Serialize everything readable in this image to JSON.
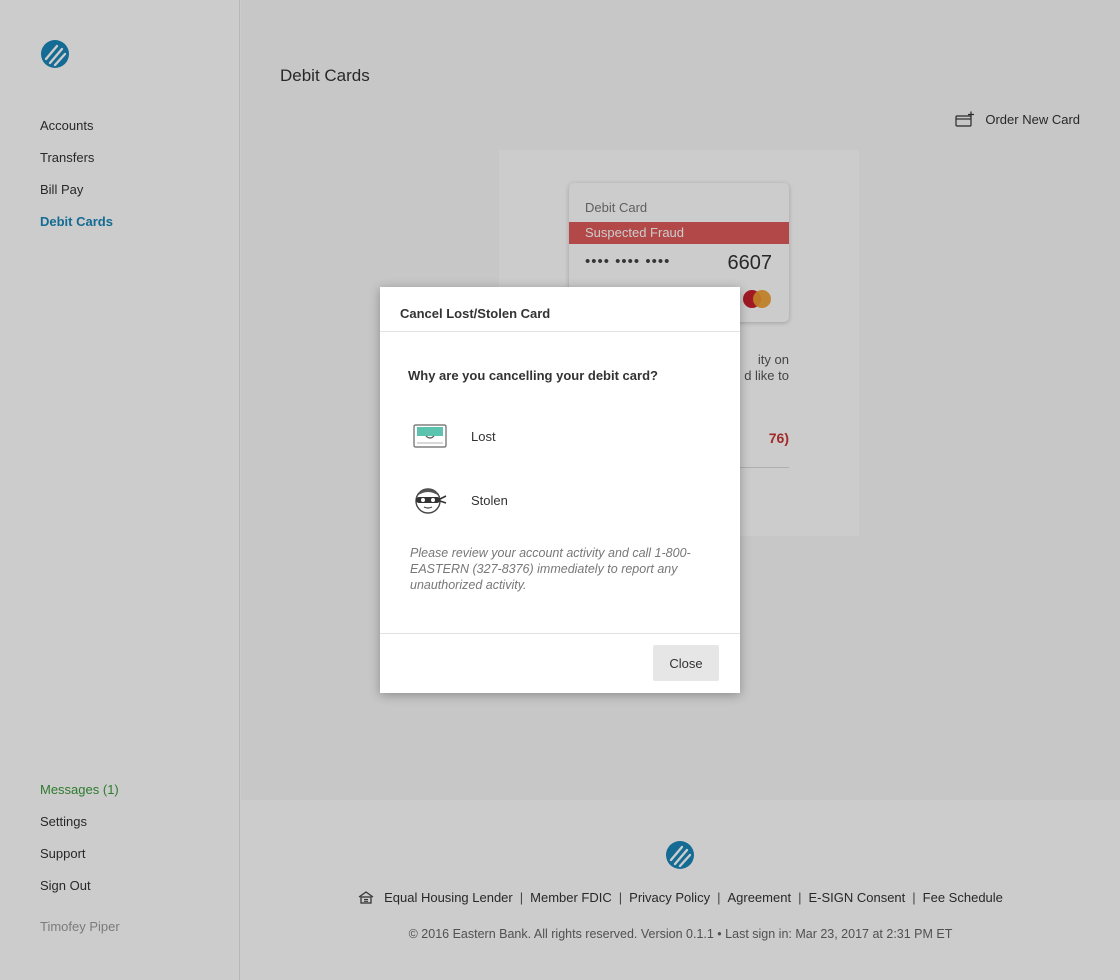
{
  "app": {
    "brand_color": "#1a86b8"
  },
  "sidebar": {
    "logo_icon": "eastern-bank-logo-icon",
    "items": [
      {
        "label": "Accounts"
      },
      {
        "label": "Transfers"
      },
      {
        "label": "Bill Pay"
      },
      {
        "label": "Debit Cards",
        "active": true
      }
    ],
    "bottom_items": [
      {
        "label": "Messages (1)"
      },
      {
        "label": "Settings"
      },
      {
        "label": "Support"
      },
      {
        "label": "Sign Out"
      }
    ],
    "user_name": "Timofey Piper"
  },
  "main": {
    "page_title": "Debit Cards",
    "order_new_card_label": "Order New Card",
    "order_new_card_icon": "card-add-icon",
    "card": {
      "label": "Debit Card",
      "status": "Suspected Fraud",
      "status_color": "#e05b5b",
      "masked_number": "•••• •••• ••••",
      "last4": "6607",
      "network_icon": "mastercard-icon"
    },
    "panel_text_partial": "ity on\nd like to",
    "panel_phone_partial": "76)"
  },
  "modal": {
    "title": "Cancel Lost/Stolen Card",
    "question": "Why are you cancelling your debit card?",
    "options": [
      {
        "label": "Lost",
        "icon": "lost-card-wallet-icon"
      },
      {
        "label": "Stolen",
        "icon": "thief-icon"
      }
    ],
    "note": "Please review your account activity and call 1-800-EASTERN (327-8376) immediately to report any unauthorized activity.",
    "close_label": "Close"
  },
  "footer": {
    "logo_icon": "eastern-bank-logo-icon",
    "links": [
      {
        "label": "Equal Housing Lender",
        "icon": "equal-housing-icon"
      },
      {
        "label": "Member FDIC"
      },
      {
        "label": "Privacy Policy"
      },
      {
        "label": "Agreement"
      },
      {
        "label": "E-SIGN Consent"
      },
      {
        "label": "Fee Schedule"
      }
    ],
    "copyright": "© 2016 Eastern Bank. All rights reserved. Version 0.1.1 • Last sign in: Mar 23, 2017 at 2:31 PM ET"
  }
}
